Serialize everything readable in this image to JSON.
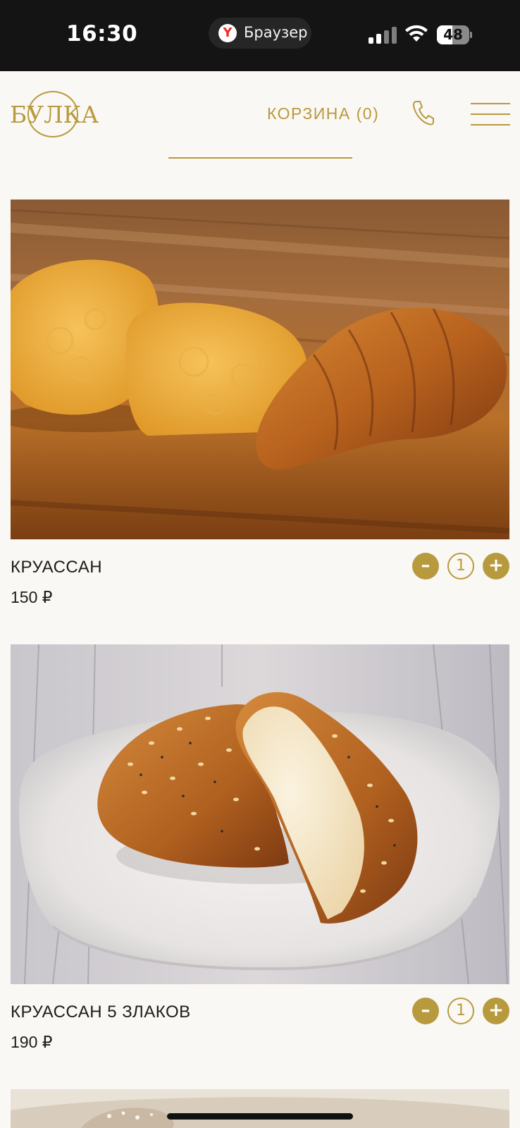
{
  "status_bar": {
    "time": "16:30",
    "browser_label": "Браузер",
    "browser_icon": "yandex-browser-icon",
    "browser_icon_letter": "Y",
    "battery_percent": "48",
    "battery_level": 0.48
  },
  "header": {
    "logo_text": "БУЛКА",
    "cart_label": "КОРЗИНА (0)",
    "phone_icon": "phone-icon",
    "menu_icon": "hamburger-menu-icon",
    "accent_color": "#b89a3e"
  },
  "products": [
    {
      "name": "КРУАССАН",
      "price": "150 ₽",
      "quantity": "1",
      "minus": "–",
      "plus": "+"
    },
    {
      "name": "КРУАССАН 5 ЗЛАКОВ",
      "price": "190 ₽",
      "quantity": "1",
      "minus": "–",
      "plus": "+"
    }
  ]
}
